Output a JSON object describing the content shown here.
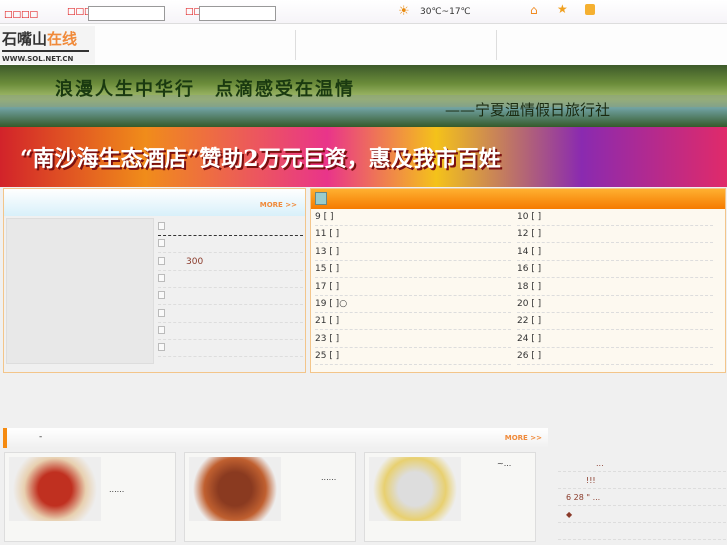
{
  "topbar": {
    "label1": "□□□□",
    "label2": "□□□",
    "label3": "□□",
    "weather": "30℃~17℃"
  },
  "logo": {
    "name_dark": "石嘴山",
    "name_orange": "在线",
    "url": "WWW.SOL.NET.CN"
  },
  "banner1": {
    "line1": "浪漫人生中华行　点滴感受在温情",
    "line2": "——宁夏温情假日旅行社"
  },
  "banner2": {
    "text": "“南沙海生态酒店”赞助2万元巨资，惠及我市百姓"
  },
  "left_panel": {
    "more": "MORE >>",
    "items": [
      "",
      "",
      "300",
      "",
      "",
      "",
      "",
      ""
    ]
  },
  "right_panel": {
    "rows": [
      [
        "9 [   ]",
        "10 [   ]"
      ],
      [
        "11 [   ]",
        "12 [   ]"
      ],
      [
        "13 [   ]",
        "14 [   ]"
      ],
      [
        "15 [   ]",
        "16 [   ]"
      ],
      [
        "17 [   ]",
        "18 [   ]"
      ],
      [
        "19 [   ]○",
        "20 [   ]"
      ],
      [
        "21 [   ]",
        "22 [   ]"
      ],
      [
        "23 [   ]",
        "24 [   ]"
      ],
      [
        "25 [   ]",
        "26 [   ]"
      ]
    ]
  },
  "food": {
    "title": "-",
    "more": "MORE >>",
    "cards": [
      {
        "caption": "......"
      },
      {
        "caption": "......"
      },
      {
        "caption": "~..."
      }
    ]
  },
  "side_list": [
    "...",
    "!!!",
    "6 28  \"     ...",
    "◆",
    ""
  ]
}
